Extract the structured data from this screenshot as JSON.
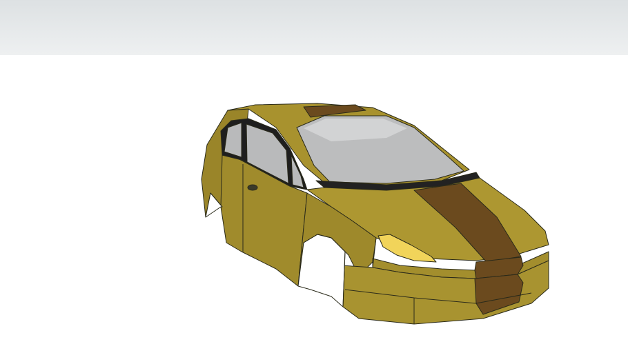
{
  "viewport": {
    "sky_color": "#e6e9ea",
    "ground_color": "#ffffff"
  },
  "model": {
    "body_color": "#a8922e",
    "body_shade_color": "#8f7b24",
    "stripe_color": "#6b4a1e",
    "glass_color": "#b8b9ba",
    "headlight_color": "#f1d45a",
    "edge_color": "#2a2a1a"
  }
}
